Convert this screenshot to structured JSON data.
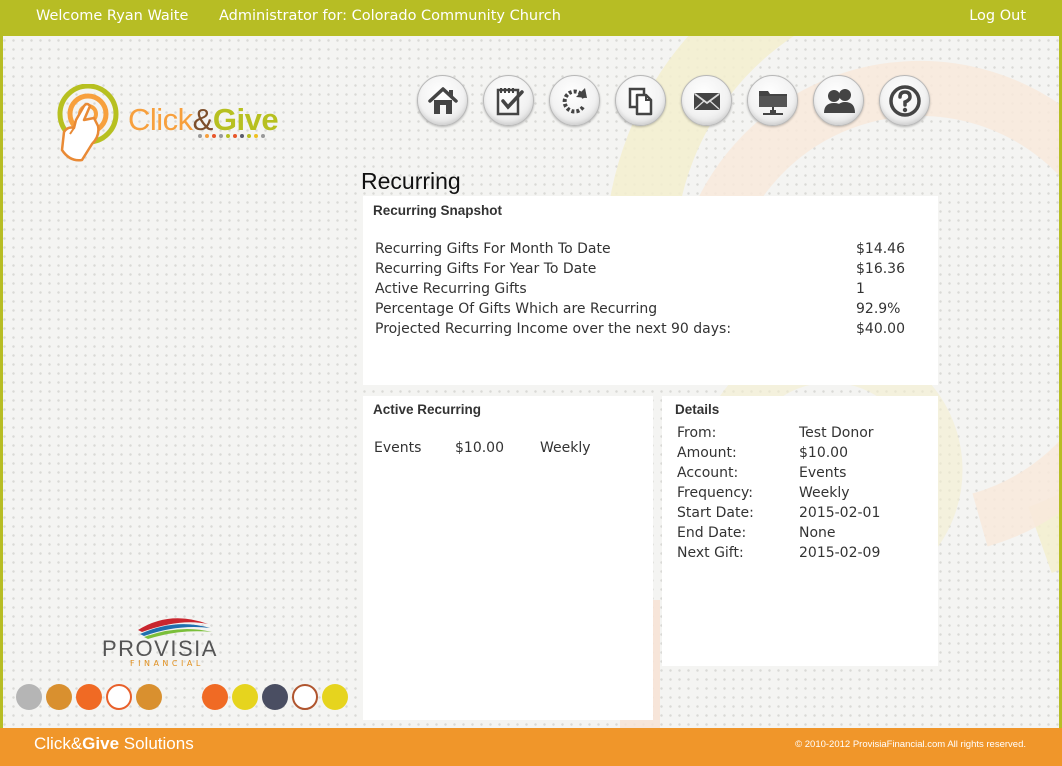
{
  "header": {
    "welcome": "Welcome Ryan Waite",
    "admin": "Administrator for: Colorado Community Church",
    "logout": "Log Out"
  },
  "logo": {
    "part1": "Click",
    "ampersand": "&",
    "part2": "Give"
  },
  "nav": [
    {
      "icon": "home-icon"
    },
    {
      "icon": "checklist-icon"
    },
    {
      "icon": "refresh-icon"
    },
    {
      "icon": "copy-icon"
    },
    {
      "icon": "mail-icon"
    },
    {
      "icon": "folder-network-icon"
    },
    {
      "icon": "users-icon"
    },
    {
      "icon": "help-icon"
    }
  ],
  "page": {
    "title": "Recurring"
  },
  "snapshot": {
    "heading": "Recurring Snapshot",
    "rows": [
      {
        "label": "Recurring Gifts For Month To Date",
        "value": "$14.46"
      },
      {
        "label": "Recurring Gifts For Year To Date",
        "value": "$16.36"
      },
      {
        "label": "Active Recurring Gifts",
        "value": "1"
      },
      {
        "label": "Percentage Of Gifts Which are Recurring",
        "value": "92.9%"
      },
      {
        "label": "Projected Recurring Income over the next 90 days:",
        "value": "$40.00"
      }
    ]
  },
  "active": {
    "heading": "Active Recurring",
    "rows": [
      {
        "account": "Events",
        "amount": "$10.00",
        "frequency": "Weekly"
      }
    ]
  },
  "details": {
    "heading": "Details",
    "rows": [
      {
        "label": "From:",
        "value": "Test Donor"
      },
      {
        "label": "Amount:",
        "value": "$10.00"
      },
      {
        "label": "Account:",
        "value": "Events"
      },
      {
        "label": "Frequency:",
        "value": "Weekly"
      },
      {
        "label": "Start Date:",
        "value": "2015-02-01"
      },
      {
        "label": "End Date:",
        "value": "None"
      },
      {
        "label": "Next Gift:",
        "value": "2015-02-09"
      }
    ]
  },
  "provisia": {
    "name": "PROVISIA",
    "sub": "FINANCIAL"
  },
  "footer": {
    "brand_part1": "Click&",
    "brand_part2": "Give",
    "brand_part3": " Solutions",
    "copyright": "© 2010-2012 ProvisiaFinancial.com   All rights reserved."
  },
  "colors": {
    "header_bar": "#b7bd24",
    "footer_bar": "#f0962a",
    "accent_orange": "#f7a03d",
    "accent_green": "#b7c020"
  }
}
